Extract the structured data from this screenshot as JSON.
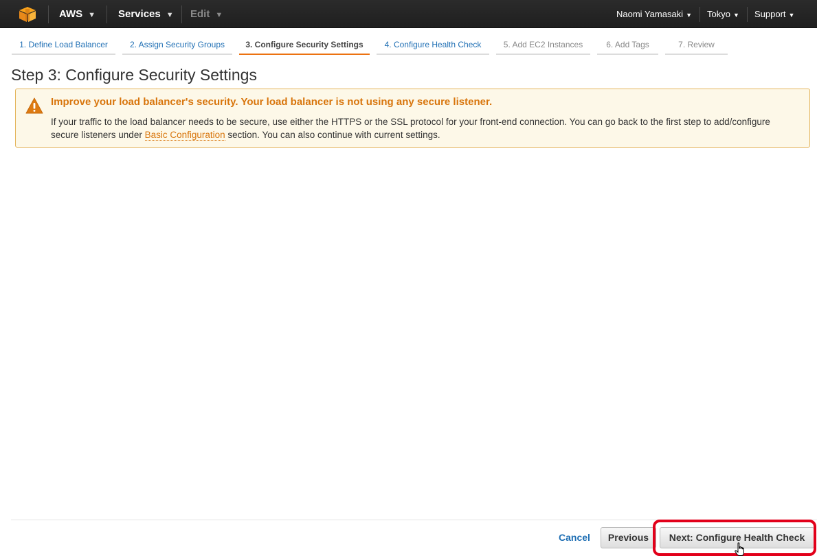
{
  "topnav": {
    "aws_label": "AWS",
    "services_label": "Services",
    "edit_label": "Edit",
    "user_label": "Naomi Yamasaki",
    "region_label": "Tokyo",
    "support_label": "Support"
  },
  "steps": [
    {
      "label": "1. Define Load Balancer",
      "state": "link"
    },
    {
      "label": "2. Assign Security Groups",
      "state": "link"
    },
    {
      "label": "3. Configure Security Settings",
      "state": "active"
    },
    {
      "label": "4. Configure Health Check",
      "state": "link"
    },
    {
      "label": "5. Add EC2 Instances",
      "state": "inactive"
    },
    {
      "label": "6. Add Tags",
      "state": "inactive"
    },
    {
      "label": "7. Review",
      "state": "inactive"
    }
  ],
  "page_title": "Step 3: Configure Security Settings",
  "warning": {
    "title": "Improve your load balancer's security. Your load balancer is not using any secure listener.",
    "text_before": "If your traffic to the load balancer needs to be secure, use either the HTTPS or the SSL protocol for your front-end connection. You can go back to the first step to add/configure secure listeners under ",
    "link": "Basic Configuration",
    "text_after": " section. You can also continue with current settings."
  },
  "footer": {
    "cancel_label": "Cancel",
    "previous_label": "Previous",
    "next_label": "Next: Configure Health Check"
  },
  "colors": {
    "accent": "#ec7211",
    "link": "#1f6fb4",
    "warning_title": "#d8750c",
    "warning_bg": "#fdf8e8",
    "highlight": "#e2001a"
  },
  "icons": {
    "logo": "aws-cube-icon",
    "warning": "warning-triangle-icon",
    "cursor": "hand-pointer-icon"
  }
}
